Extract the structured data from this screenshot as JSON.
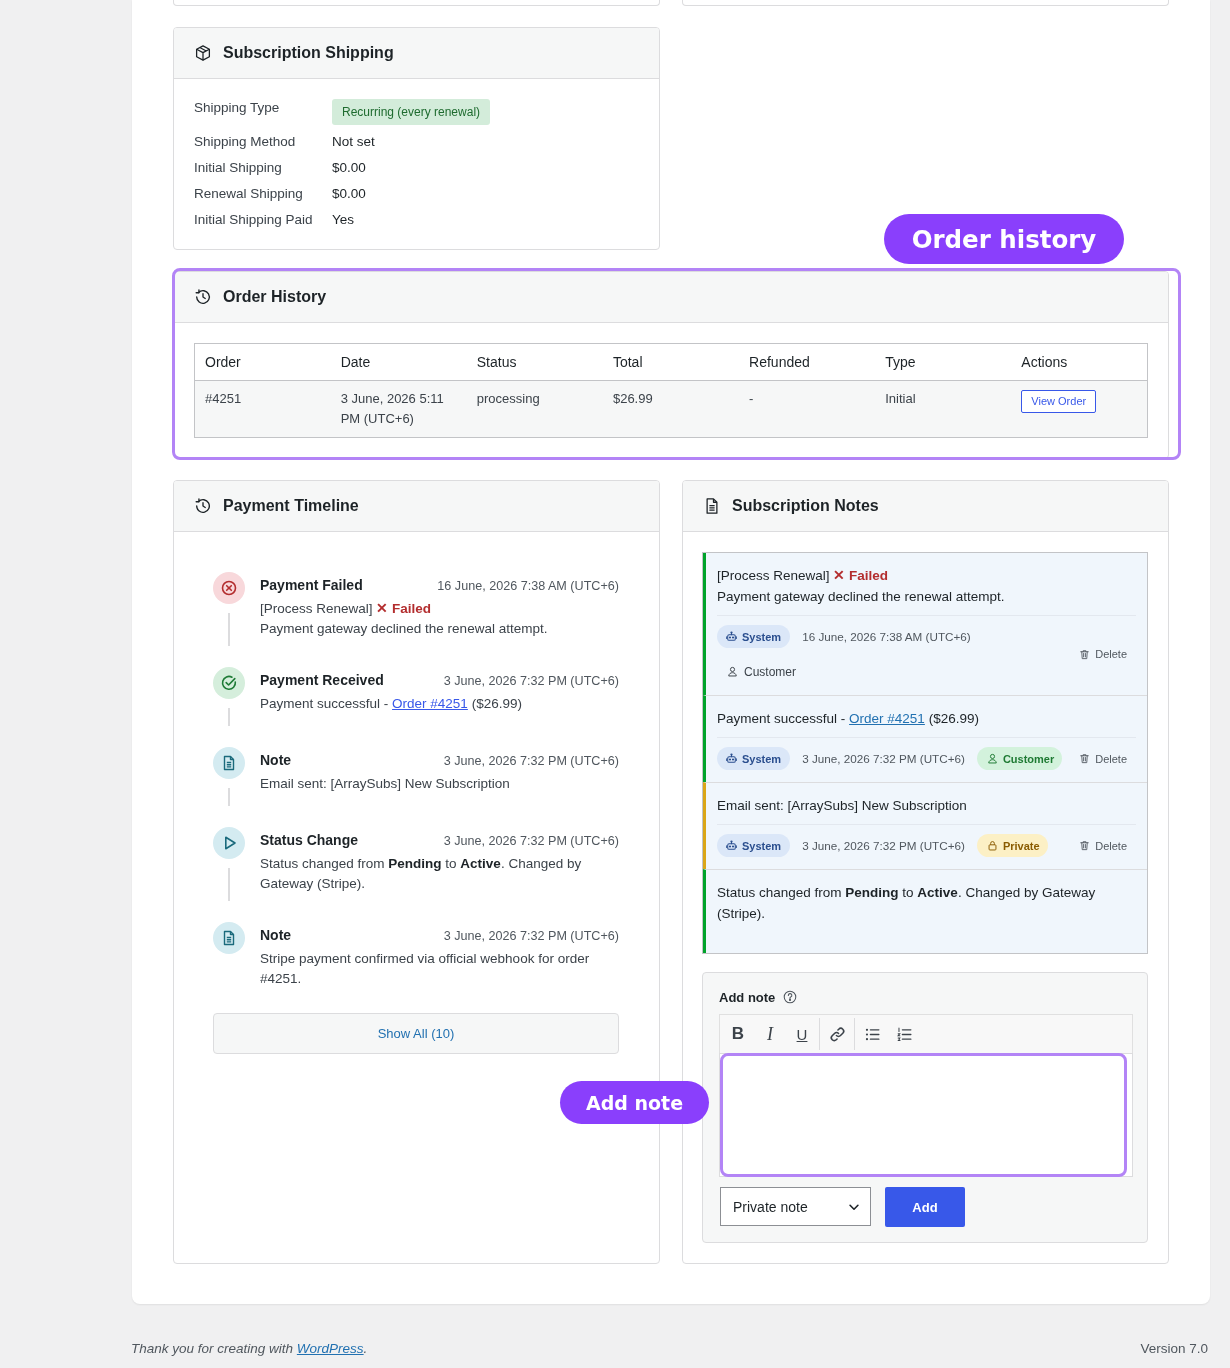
{
  "shipping": {
    "title": "Subscription Shipping",
    "rows": [
      {
        "label": "Shipping Type",
        "value": "Recurring (every renewal)",
        "kind": "badge"
      },
      {
        "label": "Shipping Method",
        "value": "Not set",
        "kind": "text"
      },
      {
        "label": "Initial Shipping",
        "value": "$0.00",
        "kind": "text"
      },
      {
        "label": "Renewal Shipping",
        "value": "$0.00",
        "kind": "text"
      },
      {
        "label": "Initial Shipping Paid",
        "value": "Yes",
        "kind": "text"
      }
    ]
  },
  "order_history": {
    "title": "Order History",
    "callout": "Order history",
    "columns": [
      "Order",
      "Date",
      "Status",
      "Total",
      "Refunded",
      "Type",
      "Actions"
    ],
    "rows": [
      {
        "cells": [
          "#4251",
          "3 June, 2026 5:11 PM (UTC+6)",
          "processing",
          "$26.99",
          "-",
          "Initial"
        ],
        "action": "View Order"
      }
    ]
  },
  "payment_timeline": {
    "title": "Payment Timeline",
    "items": [
      {
        "kind": "failed",
        "title": "Payment Failed",
        "time": "16 June, 2026 7:38 AM (UTC+6)",
        "lines": [
          [
            {
              "kind": "text",
              "text": "[Process Renewal]"
            },
            {
              "kind": "error",
              "text": "✕ Failed"
            }
          ],
          [
            {
              "kind": "text",
              "text": "Payment gateway declined the renewal attempt."
            }
          ]
        ]
      },
      {
        "kind": "received",
        "title": "Payment Received",
        "time": "3 June, 2026 7:32 PM (UTC+6)",
        "lines": [
          [
            {
              "kind": "text",
              "text": "Payment successful -"
            },
            {
              "kind": "link",
              "text": "Order #4251"
            },
            {
              "kind": "text",
              "text": "($26.99)"
            }
          ]
        ]
      },
      {
        "kind": "note",
        "title": "Note",
        "time": "3 June, 2026 7:32 PM (UTC+6)",
        "lines": [
          [
            {
              "kind": "text",
              "text": "Email sent: [ArraySubs] New Subscription"
            }
          ]
        ]
      },
      {
        "kind": "status_change",
        "title": "Status Change",
        "time": "3 June, 2026 7:32 PM (UTC+6)",
        "lines": [
          [
            {
              "kind": "text",
              "text": "Status changed from **Pending** to **Active**. Changed by Gateway (Stripe)."
            }
          ]
        ]
      },
      {
        "kind": "note",
        "title": "Note",
        "time": "3 June, 2026 7:32 PM (UTC+6)",
        "lines": [
          [
            {
              "kind": "text",
              "text": "Stripe payment confirmed via official webhook for order #4251."
            }
          ]
        ]
      }
    ],
    "show_all": "Show All (10)"
  },
  "subscription_notes": {
    "title": "Subscription Notes",
    "items": [
      {
        "kind": "customer",
        "lines": [
          [
            {
              "kind": "text",
              "text": "[Process Renewal]"
            },
            {
              "kind": "error",
              "text": "✕ Failed"
            }
          ],
          [
            {
              "kind": "text",
              "text": "Payment gateway declined the renewal attempt."
            }
          ]
        ],
        "author": "System",
        "time": "16 June, 2026 7:38 AM (UTC+6)",
        "tag": {
          "label": "Customer",
          "pill": false
        },
        "delete": "Delete"
      },
      {
        "kind": "customer",
        "lines": [
          [
            {
              "kind": "text",
              "text": "Payment successful -"
            },
            {
              "kind": "link",
              "text": "Order #4251"
            },
            {
              "kind": "text",
              "text": "($26.99)"
            }
          ]
        ],
        "author": "System",
        "time": "3 June, 2026 7:32 PM (UTC+6)",
        "tag": {
          "label": "Customer",
          "pill": true
        },
        "delete": "Delete"
      },
      {
        "kind": "private",
        "lines": [
          [
            {
              "kind": "text",
              "text": "Email sent: [ArraySubs] New Subscription"
            }
          ]
        ],
        "author": "System",
        "time": "3 June, 2026 7:32 PM (UTC+6)",
        "tag": {
          "label": "Private",
          "pill": true
        },
        "delete": "Delete"
      },
      {
        "kind": "customer",
        "lines": [
          [
            {
              "kind": "text",
              "text": "Status changed from **Pending** to **Active**. Changed by Gateway (Stripe)."
            }
          ]
        ]
      }
    ],
    "add_note": {
      "label": "Add note",
      "toolbar": [
        [
          {
            "kind": "bold",
            "label": "B"
          },
          {
            "kind": "italic",
            "label": "I"
          },
          {
            "kind": "underline",
            "label": "U"
          }
        ],
        [
          {
            "kind": "link"
          }
        ],
        [
          {
            "kind": "bullet_list"
          },
          {
            "kind": "numbered_list"
          }
        ]
      ],
      "editor": {
        "callout": "Add note"
      },
      "note_type": "Private note",
      "submit": "Add"
    }
  },
  "footer": {
    "credit": {
      "before": "Thank you for creating with",
      "link": "WordPress",
      "after": "."
    },
    "version": "Version 7.0"
  }
}
